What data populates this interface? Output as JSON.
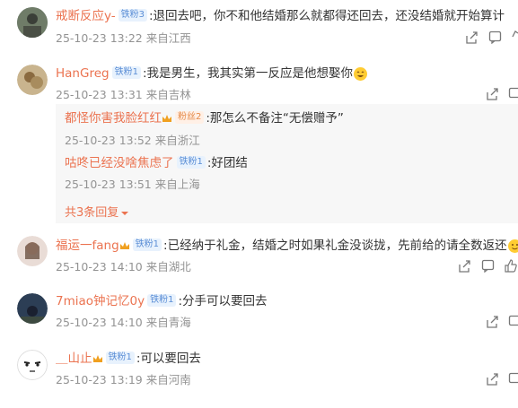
{
  "comments": [
    {
      "user": "戒断反应y-",
      "badge": "铁粉3",
      "text": ":退回去吧，你不和他结婚那么就都得还回去，还没结婚就开始算计",
      "time": "25-10-23 13:22",
      "location": "来自江西"
    },
    {
      "user": "HanGreg",
      "badge": "铁粉1",
      "text": ":我是男生，我其实第一反应是他想娶你",
      "time": "25-10-23 13:31",
      "location": "来自吉林"
    },
    {
      "user": "福运一fang",
      "badge": "铁粉1",
      "text": ":已经纳于礼金，结婚之时如果礼金没谈拢，先前给的请全数返还",
      "time": "25-10-23 14:10",
      "location": "来自湖北"
    },
    {
      "user": "7miao钟记忆0y",
      "badge": "铁粉1",
      "text": ":分手可以要回去",
      "time": "25-10-23 14:10",
      "location": "来自青海"
    },
    {
      "user": "＿山止",
      "badge": "铁粉1",
      "text": ":可以要回去",
      "time": "25-10-23 13:19",
      "location": "来自河南"
    }
  ],
  "replies": [
    {
      "user": "都怪你害我脸红红",
      "badge": "粉丝2",
      "text": ":那怎么不备注“无偿赠予”",
      "time": "25-10-23 13:52",
      "location": "来自浙江"
    },
    {
      "user": "咕咚已经没啥焦虑了",
      "badge": "铁粉1",
      "text": ":好团结",
      "time": "25-10-23 13:51",
      "location": "来自上海"
    }
  ],
  "more_replies": "共3条回复",
  "icons": [
    "share-icon",
    "comment-icon",
    "like-icon"
  ],
  "colors": {
    "username": "#eb7350",
    "meta": "#939393",
    "badge_bg": "#e8f2fd",
    "badge_fg": "#5b8ed6"
  }
}
